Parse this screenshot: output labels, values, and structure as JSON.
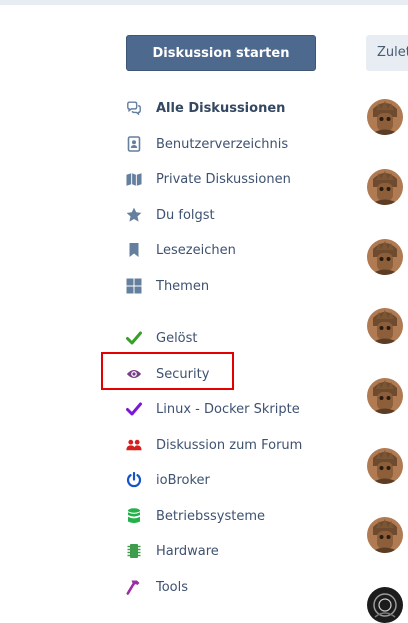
{
  "header": {
    "start_button_label": "Diskussion starten",
    "sort_button_label": "Zuletzt"
  },
  "nav": {
    "primary": [
      {
        "label": "Alle Diskussionen",
        "icon": "comments-icon",
        "active": true
      },
      {
        "label": "Benutzerverzeichnis",
        "icon": "address-book-icon"
      },
      {
        "label": "Private Diskussionen",
        "icon": "map-icon"
      },
      {
        "label": "Du folgst",
        "icon": "star-icon"
      },
      {
        "label": "Lesezeichen",
        "icon": "bookmark-icon"
      },
      {
        "label": "Themen",
        "icon": "grid-icon"
      }
    ],
    "tags": [
      {
        "label": "Gelöst",
        "icon": "check-icon",
        "color": "#3a9e2a"
      },
      {
        "label": "Security",
        "icon": "eye-icon",
        "color": "#7a3d87"
      },
      {
        "label": "Linux - Docker Skripte",
        "icon": "check-icon",
        "color": "#7a18d6"
      },
      {
        "label": "Diskussion zum Forum",
        "icon": "users-icon",
        "color": "#d62020"
      },
      {
        "label": "ioBroker",
        "icon": "power-icon",
        "color": "#1652c8"
      },
      {
        "label": "Betriebssysteme",
        "icon": "database-icon",
        "color": "#25b14a"
      },
      {
        "label": "Hardware",
        "icon": "chip-icon",
        "color": "#3f9c4c"
      },
      {
        "label": "Tools",
        "icon": "hammer-icon",
        "color": "#9a2fa3"
      }
    ]
  },
  "colors": {
    "primary_button": "#4d698e",
    "nav_icon": "#657f9f",
    "highlight": "#e30000"
  }
}
